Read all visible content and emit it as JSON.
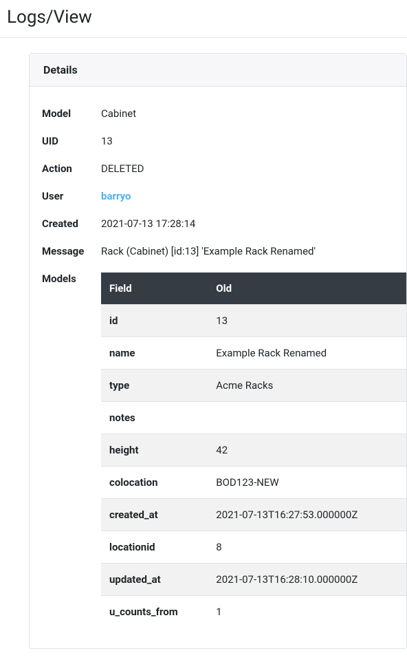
{
  "page": {
    "title": "Logs/View",
    "card_title": "Details"
  },
  "details": {
    "model_label": "Model",
    "model_value": "Cabinet",
    "uid_label": "UID",
    "uid_value": "13",
    "action_label": "Action",
    "action_value": "DELETED",
    "user_label": "User",
    "user_value": "barryo",
    "created_label": "Created",
    "created_value": "2021-07-13 17:28:14",
    "message_label": "Message",
    "message_value": "Rack (Cabinet) [id:13] 'Example Rack Renamed'",
    "models_label": "Models"
  },
  "models_table": {
    "header_field": "Field",
    "header_old": "Old",
    "rows": [
      {
        "field": "id",
        "old": "13"
      },
      {
        "field": "name",
        "old": "Example Rack Renamed"
      },
      {
        "field": "type",
        "old": "Acme Racks"
      },
      {
        "field": "notes",
        "old": ""
      },
      {
        "field": "height",
        "old": "42"
      },
      {
        "field": "colocation",
        "old": "BOD123-NEW"
      },
      {
        "field": "created_at",
        "old": "2021-07-13T16:27:53.000000Z"
      },
      {
        "field": "locationid",
        "old": "8"
      },
      {
        "field": "updated_at",
        "old": "2021-07-13T16:28:10.000000Z"
      },
      {
        "field": "u_counts_from",
        "old": "1"
      }
    ]
  }
}
